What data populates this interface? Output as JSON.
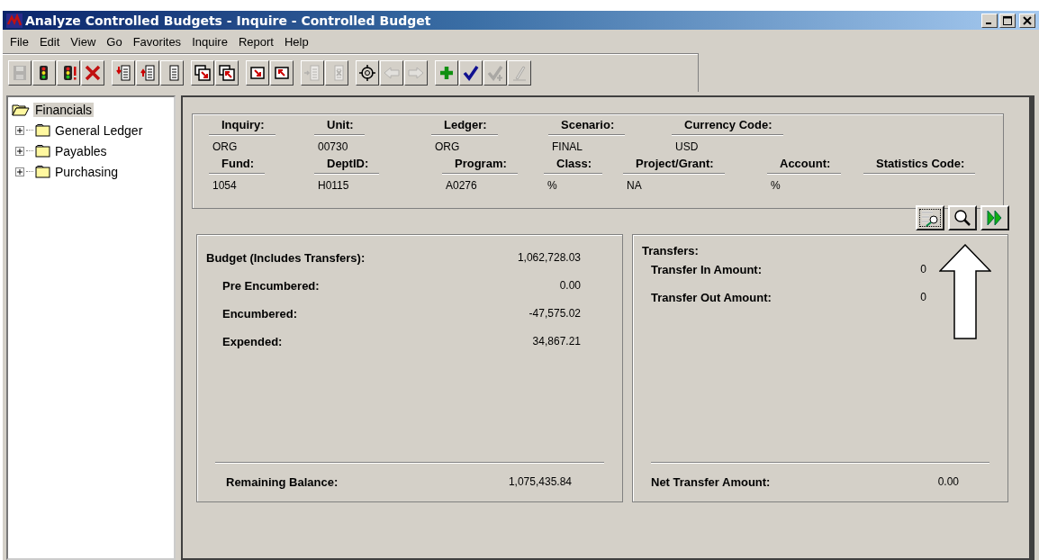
{
  "window": {
    "title": "Analyze Controlled Budgets - Inquire - Controlled Budget"
  },
  "menu": [
    "File",
    "Edit",
    "View",
    "Go",
    "Favorites",
    "Inquire",
    "Report",
    "Help"
  ],
  "toolbar": [
    [
      {
        "kind": "save",
        "disabled": true
      },
      {
        "kind": "light",
        "disabled": false
      },
      {
        "kind": "light-alert",
        "disabled": false
      },
      {
        "kind": "delete",
        "disabled": false
      }
    ],
    [
      {
        "kind": "row-down",
        "disabled": false
      },
      {
        "kind": "row-up",
        "disabled": false
      },
      {
        "kind": "list",
        "disabled": false
      }
    ],
    [
      {
        "kind": "windows-down",
        "disabled": false
      },
      {
        "kind": "windows-up",
        "disabled": false
      }
    ],
    [
      {
        "kind": "corner-down",
        "disabled": false
      },
      {
        "kind": "corner-up",
        "disabled": false
      }
    ],
    [
      {
        "kind": "row-in",
        "disabled": true
      },
      {
        "kind": "row-x",
        "disabled": true
      }
    ],
    [
      {
        "kind": "target",
        "disabled": false
      },
      {
        "kind": "back",
        "disabled": true
      },
      {
        "kind": "forward",
        "disabled": true
      }
    ],
    [
      {
        "kind": "add",
        "disabled": false
      },
      {
        "kind": "check",
        "disabled": false
      },
      {
        "kind": "check-add",
        "disabled": true
      },
      {
        "kind": "pencil",
        "disabled": true
      }
    ]
  ],
  "tree": {
    "label": "Financials",
    "expanded": true,
    "selected": true,
    "children": [
      {
        "label": "General Ledger",
        "expanded": false,
        "selected": false
      },
      {
        "label": "Payables",
        "expanded": false,
        "selected": false
      },
      {
        "label": "Purchasing",
        "expanded": false,
        "selected": false
      }
    ]
  },
  "key_fields": [
    [
      {
        "label": "Inquiry:",
        "value": "ORG"
      },
      {
        "label": "Unit:",
        "value": "00730"
      },
      {
        "label": "Ledger:",
        "value": "ORG"
      },
      {
        "label": "Scenario:",
        "value": "FINAL"
      },
      {
        "label": "Currency Code:",
        "value": "USD"
      }
    ],
    [
      {
        "label": "Fund:",
        "value": "1054"
      },
      {
        "label": "DeptID:",
        "value": "H0115"
      },
      {
        "label": "Program:",
        "value": "A0276"
      },
      {
        "label": "Class:",
        "value": "%"
      },
      {
        "label": "Project/Grant:",
        "value": "NA"
      },
      {
        "label": "Account:",
        "value": "%"
      },
      {
        "label": "Statistics Code:"
      }
    ]
  ],
  "action_buttons": [
    {
      "kind": "detail"
    },
    {
      "kind": "search"
    },
    {
      "kind": "next"
    }
  ],
  "budget": {
    "rows": [
      {
        "label": "Budget (Includes Transfers):",
        "value": "1,062,728.03",
        "indent": false
      },
      {
        "label": "Pre Encumbered:",
        "value": "0.00",
        "indent": true
      },
      {
        "label": "Encumbered:",
        "value": "-47,575.02",
        "indent": true
      },
      {
        "label": "Expended:",
        "value": "34,867.21",
        "indent": true
      }
    ],
    "total": {
      "label": "Remaining Balance:",
      "value": "1,075,435.84"
    }
  },
  "transfers": {
    "title": "Transfers:",
    "rows": [
      {
        "label": "Transfer In Amount:",
        "value": "0"
      },
      {
        "label": "Transfer Out Amount:",
        "value": "0"
      }
    ],
    "total": {
      "label": "Net Transfer Amount:",
      "value": "0.00"
    }
  }
}
